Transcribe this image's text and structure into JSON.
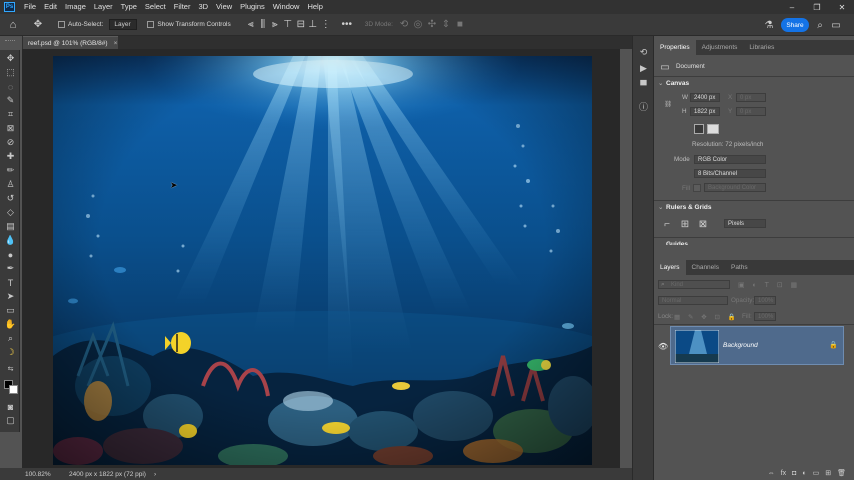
{
  "menubar": {
    "logo": "Ps",
    "items": [
      "File",
      "Edit",
      "Image",
      "Layer",
      "Type",
      "Select",
      "Filter",
      "3D",
      "View",
      "Plugins",
      "Window",
      "Help"
    ],
    "window_controls": [
      "–",
      "❐",
      "✕"
    ]
  },
  "options": {
    "auto_select_label": "Auto-Select:",
    "auto_select_value": "Layer",
    "transform_label": "Show Transform Controls",
    "mode_3d_label": "3D Mode:",
    "more": "•••",
    "share_label": "Share"
  },
  "document": {
    "tab_title": "reef.psd @ 101% (RGB/8#)",
    "close": "×"
  },
  "status": {
    "zoom": "100.82%",
    "doc_info": "2400 px x 1822 px (72 ppi)",
    "arrow": "›"
  },
  "properties": {
    "tabs": [
      "Properties",
      "Adjustments",
      "Libraries"
    ],
    "doc_label": "Document",
    "canvas_title": "Canvas",
    "w_label": "W",
    "w_value": "2400 px",
    "h_label": "H",
    "h_value": "1822 px",
    "x_label": "X",
    "x_value": "0 px",
    "y_label": "Y",
    "y_value": "0 px",
    "resolution": "Resolution: 72 pixels/inch",
    "mode_label": "Mode",
    "mode_value": "RGB Color",
    "bits_value": "8 Bits/Channel",
    "fill_label": "Fill",
    "fill_value": "Background Color",
    "rulers_title": "Rulers & Grids",
    "units_value": "Pixels",
    "guides_title": "Guides"
  },
  "layers": {
    "tabs": [
      "Layers",
      "Channels",
      "Paths"
    ],
    "kind_placeholder": "Kind",
    "blend_mode": "Normal",
    "opacity_label": "Opacity:",
    "opacity_value": "100%",
    "lock_label": "Lock:",
    "fill_label": "Fill:",
    "fill_value": "100%",
    "layer_name": "Background",
    "bottom_icons": [
      "⇔",
      "fx",
      "◘",
      "◐",
      "▭",
      "⊞",
      "🗑"
    ]
  }
}
